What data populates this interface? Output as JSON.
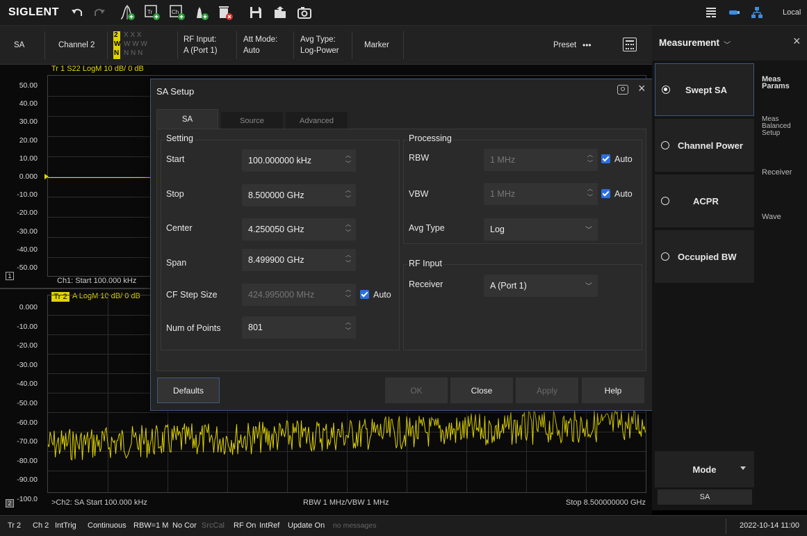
{
  "toolbar": {
    "brand": "SIGLENT",
    "local": "Local"
  },
  "chanbar": {
    "mode": "SA",
    "channel": "Channel 2",
    "trace_code": "2\nW\nN",
    "rf_input_label": "RF Input:",
    "rf_input_value": "A (Port 1)",
    "att_mode_label": "Att Mode:",
    "att_mode_value": "Auto",
    "avg_type_label": "Avg Type:",
    "avg_type_value": "Log-Power",
    "marker": "Marker",
    "preset": "Preset",
    "more": "•••"
  },
  "plot": {
    "tr1_label": "Tr 1  S22 LogM  10 dB/  0 dB",
    "tr2_tag": "Tr 2",
    "tr2_label": "A  LogM  10 dB/  0 dB",
    "ch1_footer": "Ch1: Start 100.000 kHz",
    "ch1_index": "1",
    "ch2_index": "2",
    "ch2_start": ">Ch2: SA Start 100.000 kHz",
    "ch2_bw": "RBW 1 MHz/VBW 1 MHz",
    "ch2_stop": "Stop 8.500000000 GHz",
    "y1": [
      "50.00",
      "40.00",
      "30.00",
      "20.00",
      "10.00",
      "0.000",
      "-10.00",
      "-20.00",
      "-30.00",
      "-40.00",
      "-50.00"
    ],
    "y2": [
      "0.000",
      "-10.00",
      "-20.00",
      "-30.00",
      "-40.00",
      "-50.00",
      "-60.00",
      "-70.00",
      "-80.00",
      "-90.00",
      "-100.0"
    ]
  },
  "dialog": {
    "title": "SA Setup",
    "tabs": [
      "SA",
      "Source",
      "Advanced"
    ],
    "setting_title": "Setting",
    "processing_title": "Processing",
    "rfinput_title": "RF Input",
    "start_label": "Start",
    "start_value": "100.000000 kHz",
    "stop_label": "Stop",
    "stop_value": "8.500000 GHz",
    "center_label": "Center",
    "center_value": "4.250050 GHz",
    "span_label": "Span",
    "span_value": "8.499900 GHz",
    "cfstep_label": "CF Step Size",
    "cfstep_value": "424.995000 MHz",
    "points_label": "Num of Points",
    "points_value": "801",
    "auto": "Auto",
    "rbw_label": "RBW",
    "rbw_value": "1 MHz",
    "vbw_label": "VBW",
    "vbw_value": "1 MHz",
    "avgtype_label": "Avg Type",
    "avgtype_value": "Log",
    "receiver_label": "Receiver",
    "receiver_value": "A (Port 1)",
    "buttons": {
      "defaults": "Defaults",
      "ok": "OK",
      "close": "Close",
      "apply": "Apply",
      "help": "Help"
    }
  },
  "rpanel": {
    "title": "Measurement",
    "items": [
      "Swept SA",
      "Channel Power",
      "ACPR",
      "Occupied BW"
    ],
    "side": [
      "Meas Params",
      "Meas Balanced Setup",
      "Receiver",
      "Wave"
    ],
    "mode_label": "Mode",
    "mode_value": "SA"
  },
  "status": {
    "items": [
      "Tr 2",
      "Ch 2",
      "IntTrig",
      "Continuous",
      "RBW=1 M",
      "No Cor",
      "SrcCal",
      "RF On",
      "IntRef",
      "Update On",
      "no messages"
    ],
    "datetime": "2022-10-14 11:00"
  }
}
